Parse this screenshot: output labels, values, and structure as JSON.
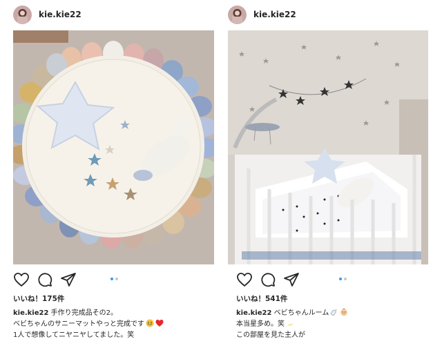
{
  "posts": [
    {
      "username": "kie.kie22",
      "likes": "いいね！175件",
      "caption": {
        "username": "kie.kie22",
        "line1": "手作り完成品その2。",
        "line2": "ベビちゃんのサニーマットやっと完成です",
        "line3": "1人で想像してニヤニヤしてました。笑"
      },
      "carousel": {
        "total": 2,
        "active": 1
      }
    },
    {
      "username": "kie.kie22",
      "likes": "いいね！541件",
      "caption": {
        "username": "kie.kie22",
        "line1": "ベビちゃんルーム",
        "line2": "本当星多め。笑",
        "line3": "この部屋を見た主人が"
      },
      "carousel": {
        "total": 2,
        "active": 1
      }
    }
  ],
  "icons": [
    "heart-icon",
    "comment-icon",
    "share-icon"
  ],
  "colors": {
    "carousel_active": "#3897f0",
    "carousel_inactive": "#c7c7c7"
  }
}
